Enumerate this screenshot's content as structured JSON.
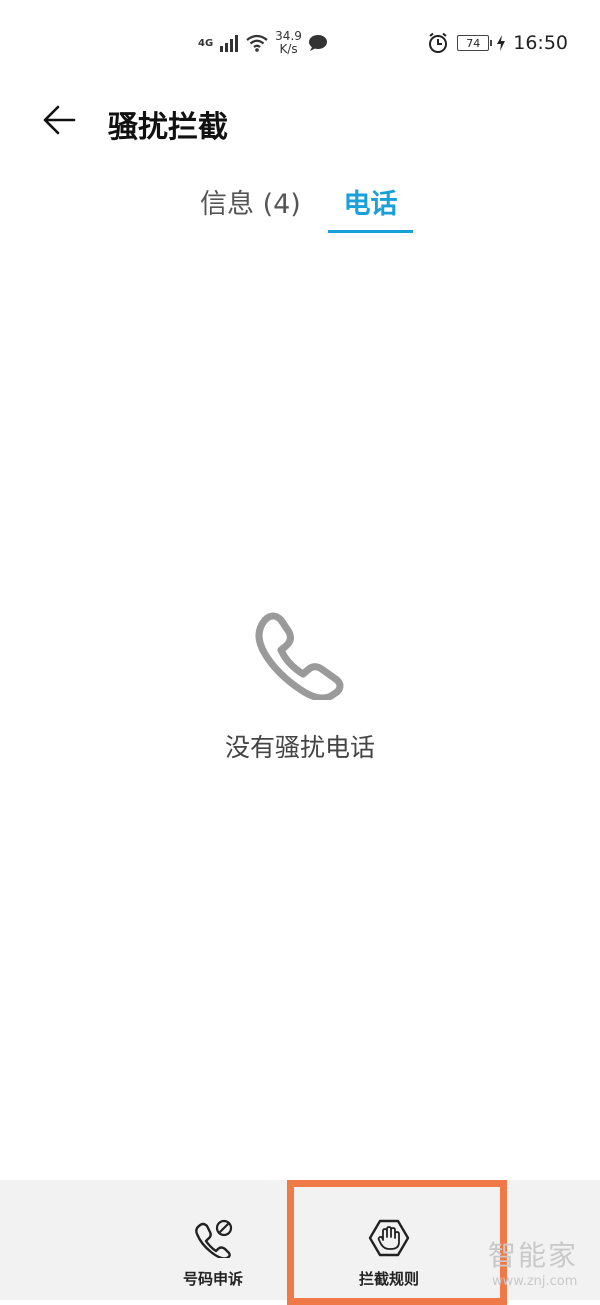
{
  "status_bar": {
    "network_type": "4G",
    "speed_value": "34.9",
    "speed_unit": "K/s",
    "battery": "74",
    "time": "16:50",
    "icons": [
      "signal-icon",
      "wifi-icon",
      "message-icon",
      "alarm-icon",
      "battery-icon",
      "charging-icon"
    ]
  },
  "app_bar": {
    "title": "骚扰拦截"
  },
  "tabs": [
    {
      "label": "信息 (4)",
      "active": false
    },
    {
      "label": "电话",
      "active": true
    }
  ],
  "empty_state": {
    "message": "没有骚扰电话",
    "icon": "phone-icon"
  },
  "bottom_bar": {
    "items": [
      {
        "label": "号码申诉",
        "icon": "phone-block-icon"
      },
      {
        "label": "拦截规则",
        "icon": "hand-stop-icon"
      }
    ]
  },
  "watermark": {
    "main": "智能家",
    "sub": "www.znj.com"
  },
  "colors": {
    "accent": "#1aa0d8",
    "highlight": "#f07a47",
    "bottom_bar_bg": "#f2f2f2"
  }
}
